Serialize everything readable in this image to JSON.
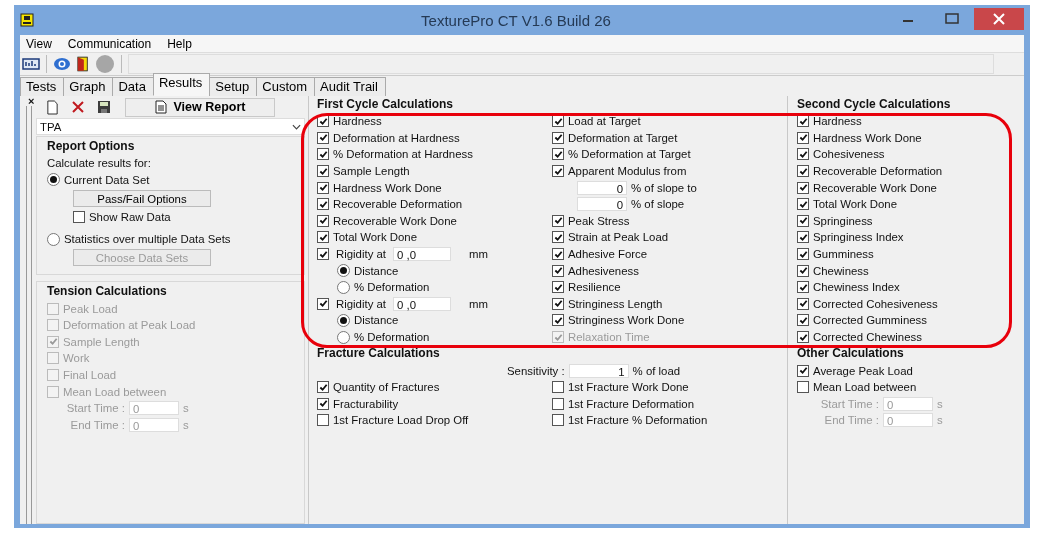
{
  "window": {
    "title": "TexturePro CT V1.6 Build 26"
  },
  "menu": [
    "View",
    "Communication",
    "Help"
  ],
  "tabs": [
    {
      "label": "Tests",
      "selected": false
    },
    {
      "label": "Graph",
      "selected": false
    },
    {
      "label": "Data",
      "selected": false
    },
    {
      "label": "Results",
      "selected": true
    },
    {
      "label": "Setup",
      "selected": false
    },
    {
      "label": "Custom",
      "selected": false
    },
    {
      "label": "Audit Trail",
      "selected": false
    }
  ],
  "left_panel": {
    "close": "×",
    "view_report": "View Report",
    "method": "TPA",
    "report_options": {
      "title": "Report Options",
      "prompt": "Calculate results for:",
      "scopes": [
        {
          "label": "Current Data Set",
          "selected": true
        },
        {
          "label": "Statistics over multiple Data Sets",
          "selected": false
        }
      ],
      "pass_fail": "Pass/Fail Options",
      "show_raw_data": {
        "label": "Show Raw Data",
        "checked": false
      },
      "choose": {
        "label": "Choose Data Sets",
        "disabled": true
      }
    },
    "tension": {
      "title": "Tension Calculations",
      "items": [
        {
          "label": "Peak Load",
          "checked": false,
          "disabled": true
        },
        {
          "label": "Deformation at Peak Load",
          "checked": false,
          "disabled": true
        },
        {
          "label": "Sample Length",
          "checked": true,
          "disabled": true
        },
        {
          "label": "Work",
          "checked": false,
          "disabled": true
        },
        {
          "label": "Final Load",
          "checked": false,
          "disabled": true
        },
        {
          "label": "Mean Load between",
          "checked": false,
          "disabled": true
        }
      ],
      "times": [
        {
          "label": "Start Time :",
          "value": "0",
          "unit": "s"
        },
        {
          "label": "End Time :",
          "value": "0",
          "unit": "s"
        }
      ]
    }
  },
  "first_cycle": {
    "title": "First Cycle Calculations",
    "columns": [
      [
        {
          "kind": "check",
          "label": "Hardness",
          "checked": true,
          "disabled": false
        },
        {
          "kind": "check",
          "label": "Deformation at Hardness",
          "checked": true,
          "disabled": false
        },
        {
          "kind": "check",
          "label": "% Deformation at Hardness",
          "checked": true,
          "disabled": false
        },
        {
          "kind": "check",
          "label": "Sample Length",
          "checked": true,
          "disabled": false
        },
        {
          "kind": "check",
          "label": "Hardness Work Done",
          "checked": true,
          "disabled": false
        },
        {
          "kind": "check",
          "label": "Recoverable Deformation",
          "checked": true,
          "disabled": false
        },
        {
          "kind": "check",
          "label": "Recoverable Work Done",
          "checked": true,
          "disabled": false
        },
        {
          "kind": "check",
          "label": "Total Work Done",
          "checked": true,
          "disabled": false
        },
        {
          "kind": "rigidity",
          "label": "Rigidity at",
          "checked": true,
          "value": "0 ,0",
          "unit": "mm",
          "disabled": false
        },
        {
          "kind": "radio",
          "label": "Distance",
          "selected": true,
          "disabled": false
        },
        {
          "kind": "radio",
          "label": "% Deformation",
          "selected": false,
          "disabled": false
        },
        {
          "kind": "rigidity",
          "label": "Rigidity at",
          "checked": true,
          "value": "0 ,0",
          "unit": "mm",
          "disabled": false
        },
        {
          "kind": "radio",
          "label": "Distance",
          "selected": true,
          "disabled": false
        },
        {
          "kind": "radio",
          "label": "% Deformation",
          "selected": false,
          "disabled": false
        }
      ],
      [
        {
          "kind": "check",
          "label": "Load at Target",
          "checked": true,
          "disabled": false
        },
        {
          "kind": "check",
          "label": "Deformation at Target",
          "checked": true,
          "disabled": false
        },
        {
          "kind": "check",
          "label": "% Deformation at Target",
          "checked": true,
          "disabled": false
        },
        {
          "kind": "check",
          "label": "Apparent Modulus from",
          "checked": true,
          "disabled": false
        },
        {
          "kind": "slope",
          "value": "0",
          "unit": "% of slope to",
          "disabled": false
        },
        {
          "kind": "slope",
          "value": "0",
          "unit": "% of slope",
          "disabled": false
        },
        {
          "kind": "check",
          "label": "Peak Stress",
          "checked": true,
          "disabled": false
        },
        {
          "kind": "check",
          "label": "Strain at Peak Load",
          "checked": true,
          "disabled": false
        },
        {
          "kind": "check",
          "label": "Adhesive Force",
          "checked": true,
          "disabled": false
        },
        {
          "kind": "check",
          "label": "Adhesiveness",
          "checked": true,
          "disabled": false
        },
        {
          "kind": "check",
          "label": "Resilience",
          "checked": true,
          "disabled": false
        },
        {
          "kind": "check",
          "label": "Stringiness Length",
          "checked": true,
          "disabled": false
        },
        {
          "kind": "check",
          "label": "Stringiness Work Done",
          "checked": true,
          "disabled": false
        },
        {
          "kind": "check",
          "label": "Relaxation Time",
          "checked": true,
          "disabled": true
        }
      ]
    ]
  },
  "fracture": {
    "title": "Fracture Calculations",
    "sensitivity": {
      "label": "Sensitivity :",
      "value": "1",
      "unit": "% of load"
    },
    "columns": [
      [
        {
          "label": "Quantity of Fractures",
          "checked": true
        },
        {
          "label": "Fracturability",
          "checked": true
        },
        {
          "label": "1st Fracture Load Drop Off",
          "checked": false
        }
      ],
      [
        {
          "label": "1st Fracture Work Done",
          "checked": false
        },
        {
          "label": "1st Fracture Deformation",
          "checked": false
        },
        {
          "label": "1st Fracture % Deformation",
          "checked": false
        }
      ]
    ]
  },
  "second_cycle": {
    "title": "Second Cycle Calculations",
    "items": [
      {
        "label": "Hardness",
        "checked": true
      },
      {
        "label": "Hardness Work Done",
        "checked": true
      },
      {
        "label": "Cohesiveness",
        "checked": true
      },
      {
        "label": "Recoverable Deformation",
        "checked": true
      },
      {
        "label": "Recoverable Work Done",
        "checked": true
      },
      {
        "label": "Total Work Done",
        "checked": true
      },
      {
        "label": "Springiness",
        "checked": true
      },
      {
        "label": "Springiness Index",
        "checked": true
      },
      {
        "label": "Gumminess",
        "checked": true
      },
      {
        "label": "Chewiness",
        "checked": true
      },
      {
        "label": "Chewiness Index",
        "checked": true
      },
      {
        "label": "Corrected Cohesiveness",
        "checked": true
      },
      {
        "label": "Corrected Gumminess",
        "checked": true
      },
      {
        "label": "Corrected Chewiness",
        "checked": true
      }
    ]
  },
  "other": {
    "title": "Other Calculations",
    "items": [
      {
        "label": "Average Peak Load",
        "checked": true
      },
      {
        "label": "Mean Load between",
        "checked": false
      }
    ],
    "times": [
      {
        "label": "Start Time :",
        "value": "0",
        "unit": "s"
      },
      {
        "label": "End Time :",
        "value": "0",
        "unit": "s"
      }
    ]
  }
}
